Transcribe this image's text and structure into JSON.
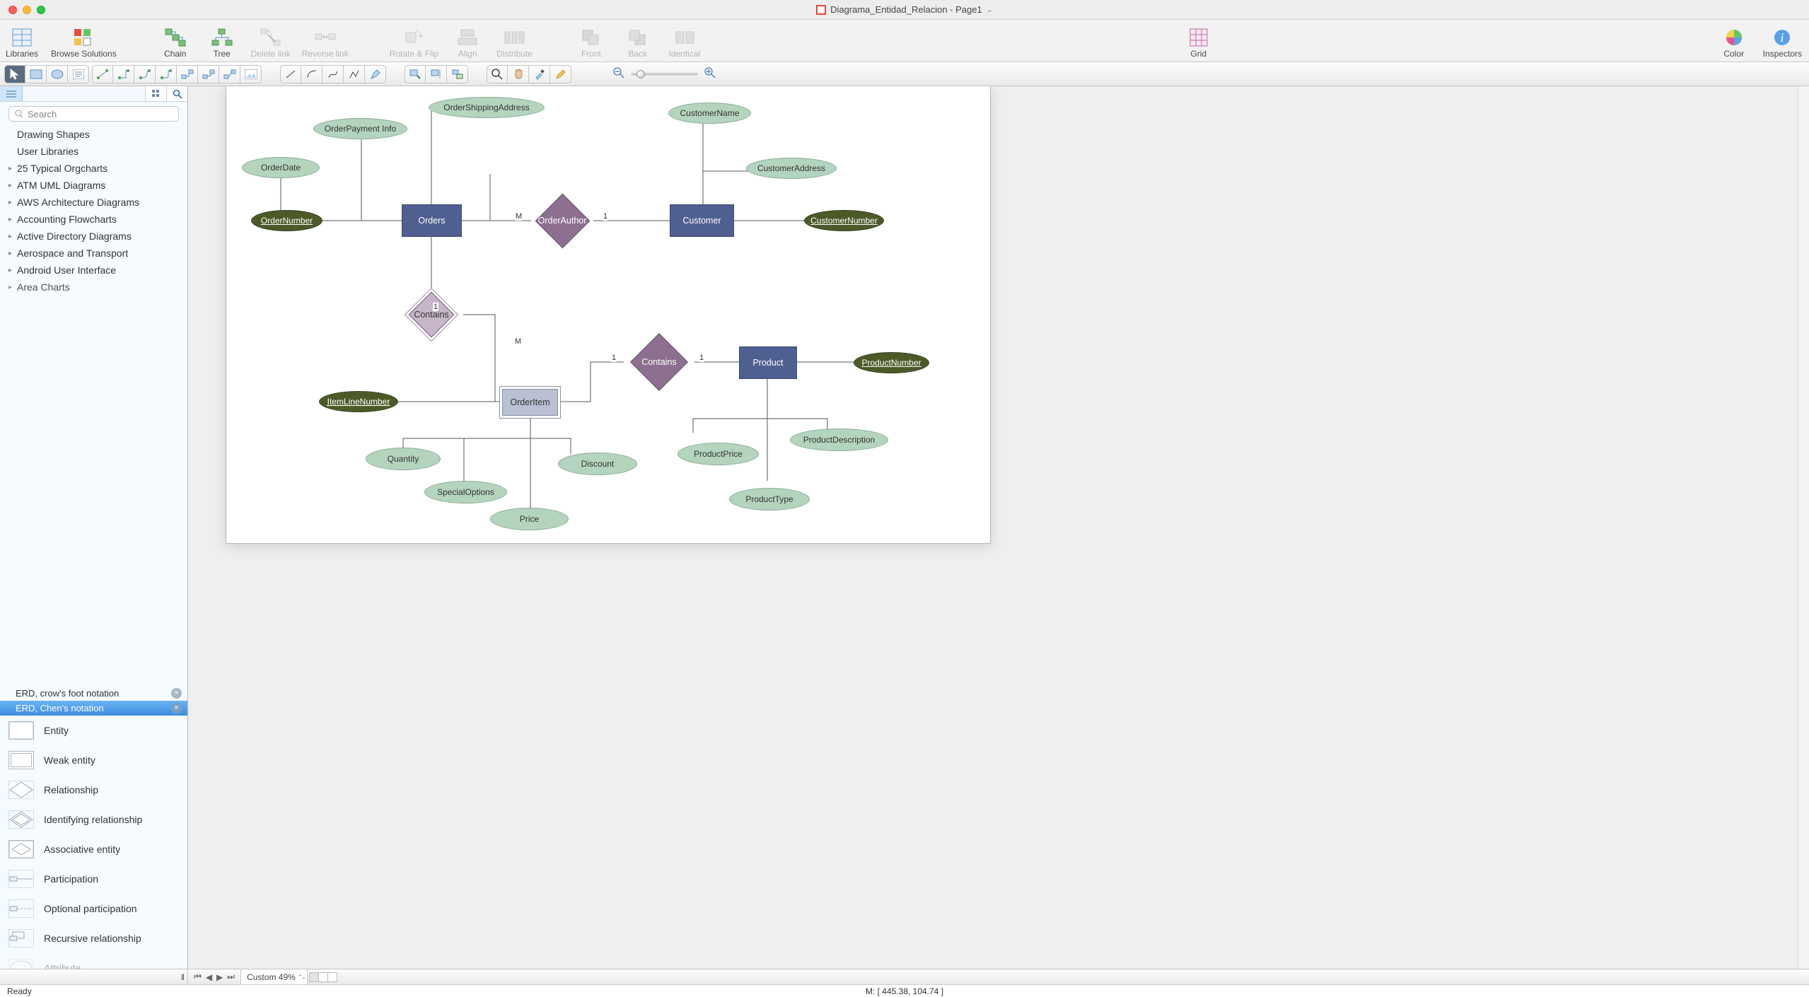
{
  "title": "Diagrama_Entidad_Relacion - Page1",
  "toolbar": {
    "libraries": "Libraries",
    "browse_solutions": "Browse Solutions",
    "chain": "Chain",
    "tree": "Tree",
    "delete_link": "Delete link",
    "reverse_link": "Reverse link",
    "rotate_flip": "Rotate & Flip",
    "align": "Align",
    "distribute": "Distribute",
    "front": "Front",
    "back": "Back",
    "identical": "Identical",
    "grid": "Grid",
    "color": "Color",
    "inspectors": "Inspectors"
  },
  "sidebar": {
    "search_placeholder": "Search",
    "categories": [
      "Drawing Shapes",
      "User Libraries",
      "25 Typical Orgcharts",
      "ATM UML Diagrams",
      "AWS Architecture Diagrams",
      "Accounting Flowcharts",
      "Active Directory Diagrams",
      "Aerospace and Transport",
      "Android User Interface",
      "Area Charts"
    ],
    "notation_crows_foot": "ERD, crow's foot notation",
    "notation_chen": "ERD, Chen's notation",
    "shapes": {
      "entity": "Entity",
      "weak_entity": "Weak entity",
      "relationship": "Relationship",
      "identifying_relationship": "Identifying relationship",
      "associative_entity": "Associative entity",
      "participation": "Participation",
      "optional_participation": "Optional participation",
      "recursive_relationship": "Recursive relationship",
      "attribute": "Attribute"
    }
  },
  "erd": {
    "orders": "Orders",
    "customer": "Customer",
    "product": "Product",
    "order_item": "OrderItem",
    "order_author": "OrderAuthor",
    "contains1": "Contains",
    "contains2": "Contains",
    "order_number": "OrderNumber",
    "customer_number": "CustomerNumber",
    "product_number": "ProductNumber",
    "item_line_number": "ItemLineNumber",
    "order_date": "OrderDate",
    "order_payment_info": "OrderPayment Info",
    "order_shipping_address": "OrderShippingAddress",
    "customer_name": "CustomerName",
    "customer_address": "CustomerAddress",
    "quantity": "Quantity",
    "special_options": "SpecialOptions",
    "price": "Price",
    "discount": "Discount",
    "product_price": "ProductPrice",
    "product_type": "ProductType",
    "product_description": "ProductDescription",
    "card_M1": "M",
    "card_1a": "1",
    "card_1b": "1",
    "card_Mc": "M",
    "card_1d": "1",
    "card_1e": "1"
  },
  "page_bar": {
    "zoom": "Custom 49%"
  },
  "status": {
    "ready": "Ready",
    "mouse": "M: [ 445.38, 104.74 ]"
  }
}
